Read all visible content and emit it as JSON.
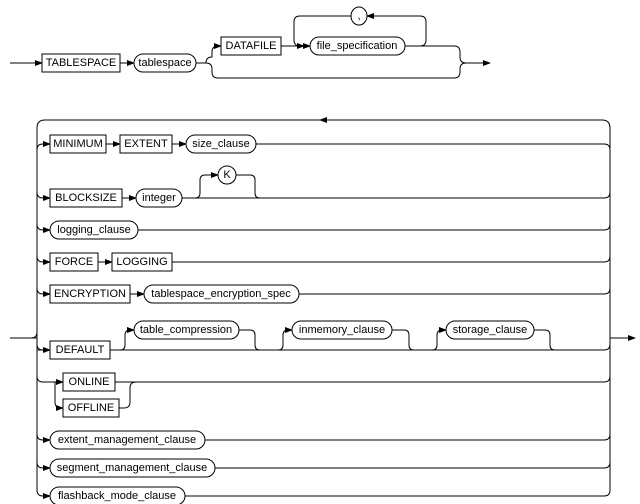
{
  "diagram": {
    "type": "railroad_syntax_diagram",
    "description": "SQL CREATE TABLESPACE permanent_tablespace_clause syntax diagram",
    "top_section": {
      "keyword1": "TABLESPACE",
      "clause1": "tablespace",
      "keyword2": "DATAFILE",
      "clause2": "file_specification",
      "separator": ","
    },
    "options": [
      {
        "type": "sequence",
        "elements": [
          {
            "kind": "keyword",
            "text": "MINIMUM"
          },
          {
            "kind": "keyword",
            "text": "EXTENT"
          },
          {
            "kind": "clause",
            "text": "size_clause"
          }
        ]
      },
      {
        "type": "sequence",
        "elements": [
          {
            "kind": "keyword",
            "text": "BLOCKSIZE"
          },
          {
            "kind": "clause",
            "text": "integer"
          },
          {
            "kind": "optional_keyword",
            "text": "K"
          }
        ]
      },
      {
        "type": "single",
        "elements": [
          {
            "kind": "clause",
            "text": "logging_clause"
          }
        ]
      },
      {
        "type": "sequence",
        "elements": [
          {
            "kind": "keyword",
            "text": "FORCE"
          },
          {
            "kind": "keyword",
            "text": "LOGGING"
          }
        ]
      },
      {
        "type": "sequence",
        "elements": [
          {
            "kind": "keyword",
            "text": "ENCRYPTION"
          },
          {
            "kind": "clause",
            "text": "tablespace_encryption_spec"
          }
        ]
      },
      {
        "type": "sequence_optional_3",
        "elements": [
          {
            "kind": "keyword",
            "text": "DEFAULT"
          },
          {
            "kind": "optional_clause",
            "text": "table_compression"
          },
          {
            "kind": "optional_clause",
            "text": "inmemory_clause"
          },
          {
            "kind": "optional_clause",
            "text": "storage_clause"
          }
        ]
      },
      {
        "type": "choice",
        "elements": [
          {
            "kind": "keyword",
            "text": "ONLINE"
          },
          {
            "kind": "keyword",
            "text": "OFFLINE"
          }
        ]
      },
      {
        "type": "single",
        "elements": [
          {
            "kind": "clause",
            "text": "extent_management_clause"
          }
        ]
      },
      {
        "type": "single",
        "elements": [
          {
            "kind": "clause",
            "text": "segment_management_clause"
          }
        ]
      },
      {
        "type": "single",
        "elements": [
          {
            "kind": "clause",
            "text": "flashback_mode_clause"
          }
        ]
      }
    ]
  }
}
